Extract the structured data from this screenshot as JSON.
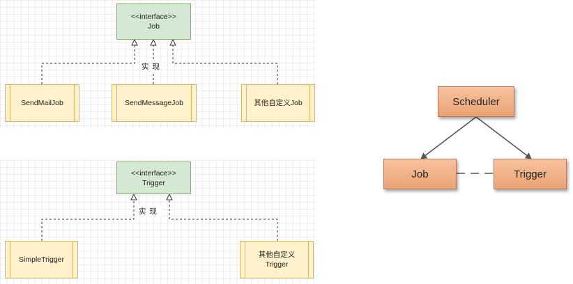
{
  "job_diagram": {
    "interface": {
      "stereotype": "<<interface>>",
      "name": "Job"
    },
    "relation_label": "实现",
    "implementations": [
      "SendMailJob",
      "SendMessageJob",
      "其他自定义Job"
    ]
  },
  "trigger_diagram": {
    "interface": {
      "stereotype": "<<interface>>",
      "name": "Trigger"
    },
    "relation_label": "实现",
    "implementations": [
      "SimpleTrigger",
      "其他自定义\nTrigger"
    ]
  },
  "scheduler_diagram": {
    "nodes": {
      "scheduler": "Scheduler",
      "job": "Job",
      "trigger": "Trigger"
    }
  },
  "colors": {
    "interface_fill": "#d5e8d4",
    "interface_border": "#82b366",
    "class_fill": "#fff2cc",
    "class_border": "#d6b656",
    "node_fill": "#f0b188"
  }
}
